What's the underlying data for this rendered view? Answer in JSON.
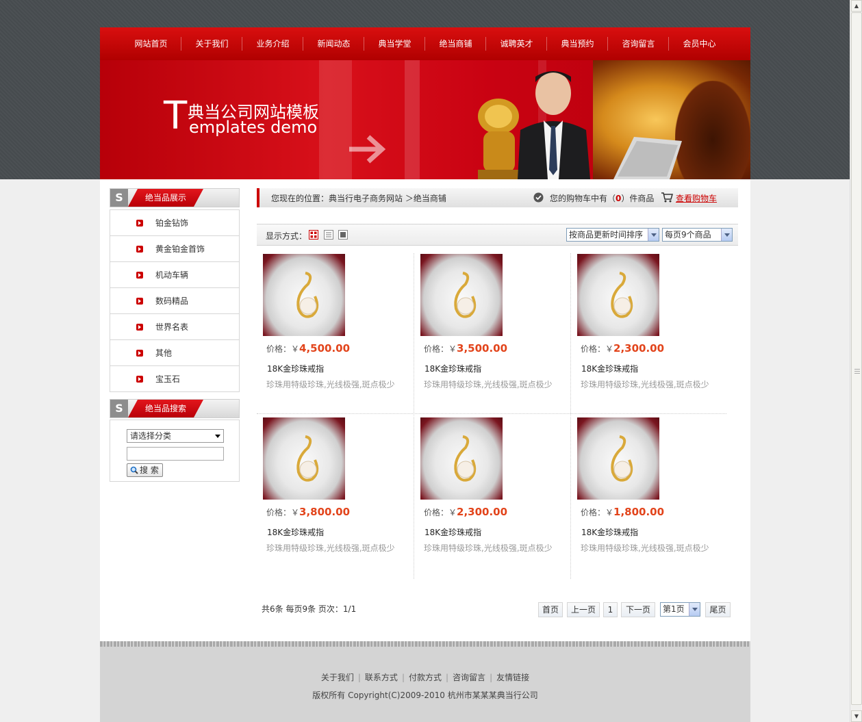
{
  "nav": [
    "网站首页",
    "关于我们",
    "业务介绍",
    "新闻动态",
    "典当学堂",
    "绝当商铺",
    "诚聘英才",
    "典当预约",
    "咨询留言",
    "会员中心"
  ],
  "banner": {
    "big_letter": "T",
    "title_cn": "典当公司网站模板",
    "title_en": "emplates demo"
  },
  "sidebar": {
    "s_letter": "S",
    "categories_title": "绝当品展示",
    "categories": [
      "铂金钻饰",
      "黄金铂金首饰",
      "机动车辆",
      "数码精品",
      "世界名表",
      "其他",
      "宝玉石"
    ],
    "search_title": "绝当品搜索",
    "search_select": "请选择分类",
    "search_button": "搜 索"
  },
  "breadcrumb": {
    "text": "您现在的位置：典当行电子商务网站 ＞绝当商铺",
    "cart_prefix": "您的购物车中有（",
    "cart_count": "0",
    "cart_suffix": "）件商品",
    "cart_link": "查看购物车"
  },
  "toolbar": {
    "label": "显示方式：",
    "sort_select": "按商品更新时间排序",
    "per_page_select": "每页9个商品"
  },
  "products": [
    {
      "price_label": "价格：￥",
      "price": "4,500.00",
      "name": "18K金珍珠戒指",
      "desc": "珍珠用特级珍珠,光线极强,斑点极少"
    },
    {
      "price_label": "价格：￥",
      "price": "3,500.00",
      "name": "18K金珍珠戒指",
      "desc": "珍珠用特级珍珠,光线极强,斑点极少"
    },
    {
      "price_label": "价格：￥",
      "price": "2,300.00",
      "name": "18K金珍珠戒指",
      "desc": "珍珠用特级珍珠,光线极强,斑点极少"
    },
    {
      "price_label": "价格：￥",
      "price": "3,800.00",
      "name": "18K金珍珠戒指",
      "desc": "珍珠用特级珍珠,光线极强,斑点极少"
    },
    {
      "price_label": "价格：￥",
      "price": "2,300.00",
      "name": "18K金珍珠戒指",
      "desc": "珍珠用特级珍珠,光线极强,斑点极少"
    },
    {
      "price_label": "价格：￥",
      "price": "1,800.00",
      "name": "18K金珍珠戒指",
      "desc": "珍珠用特级珍珠,光线极强,斑点极少"
    }
  ],
  "pagination": {
    "info": "共6条  每页9条  页次：1/1",
    "first": "首页",
    "prev": "上一页",
    "current": "1",
    "next": "下一页",
    "page_select": "第1页",
    "last": "尾页"
  },
  "footer": {
    "links": [
      "关于我们",
      "联系方式",
      "付款方式",
      "咨询留言",
      "友情链接"
    ],
    "separator": "|",
    "copyright": "版权所有  Copyright(C)2009-2010 杭州市某某某典当行公司"
  },
  "colors": {
    "brand_red": "#c00000",
    "price_orange": "#e2441b"
  }
}
